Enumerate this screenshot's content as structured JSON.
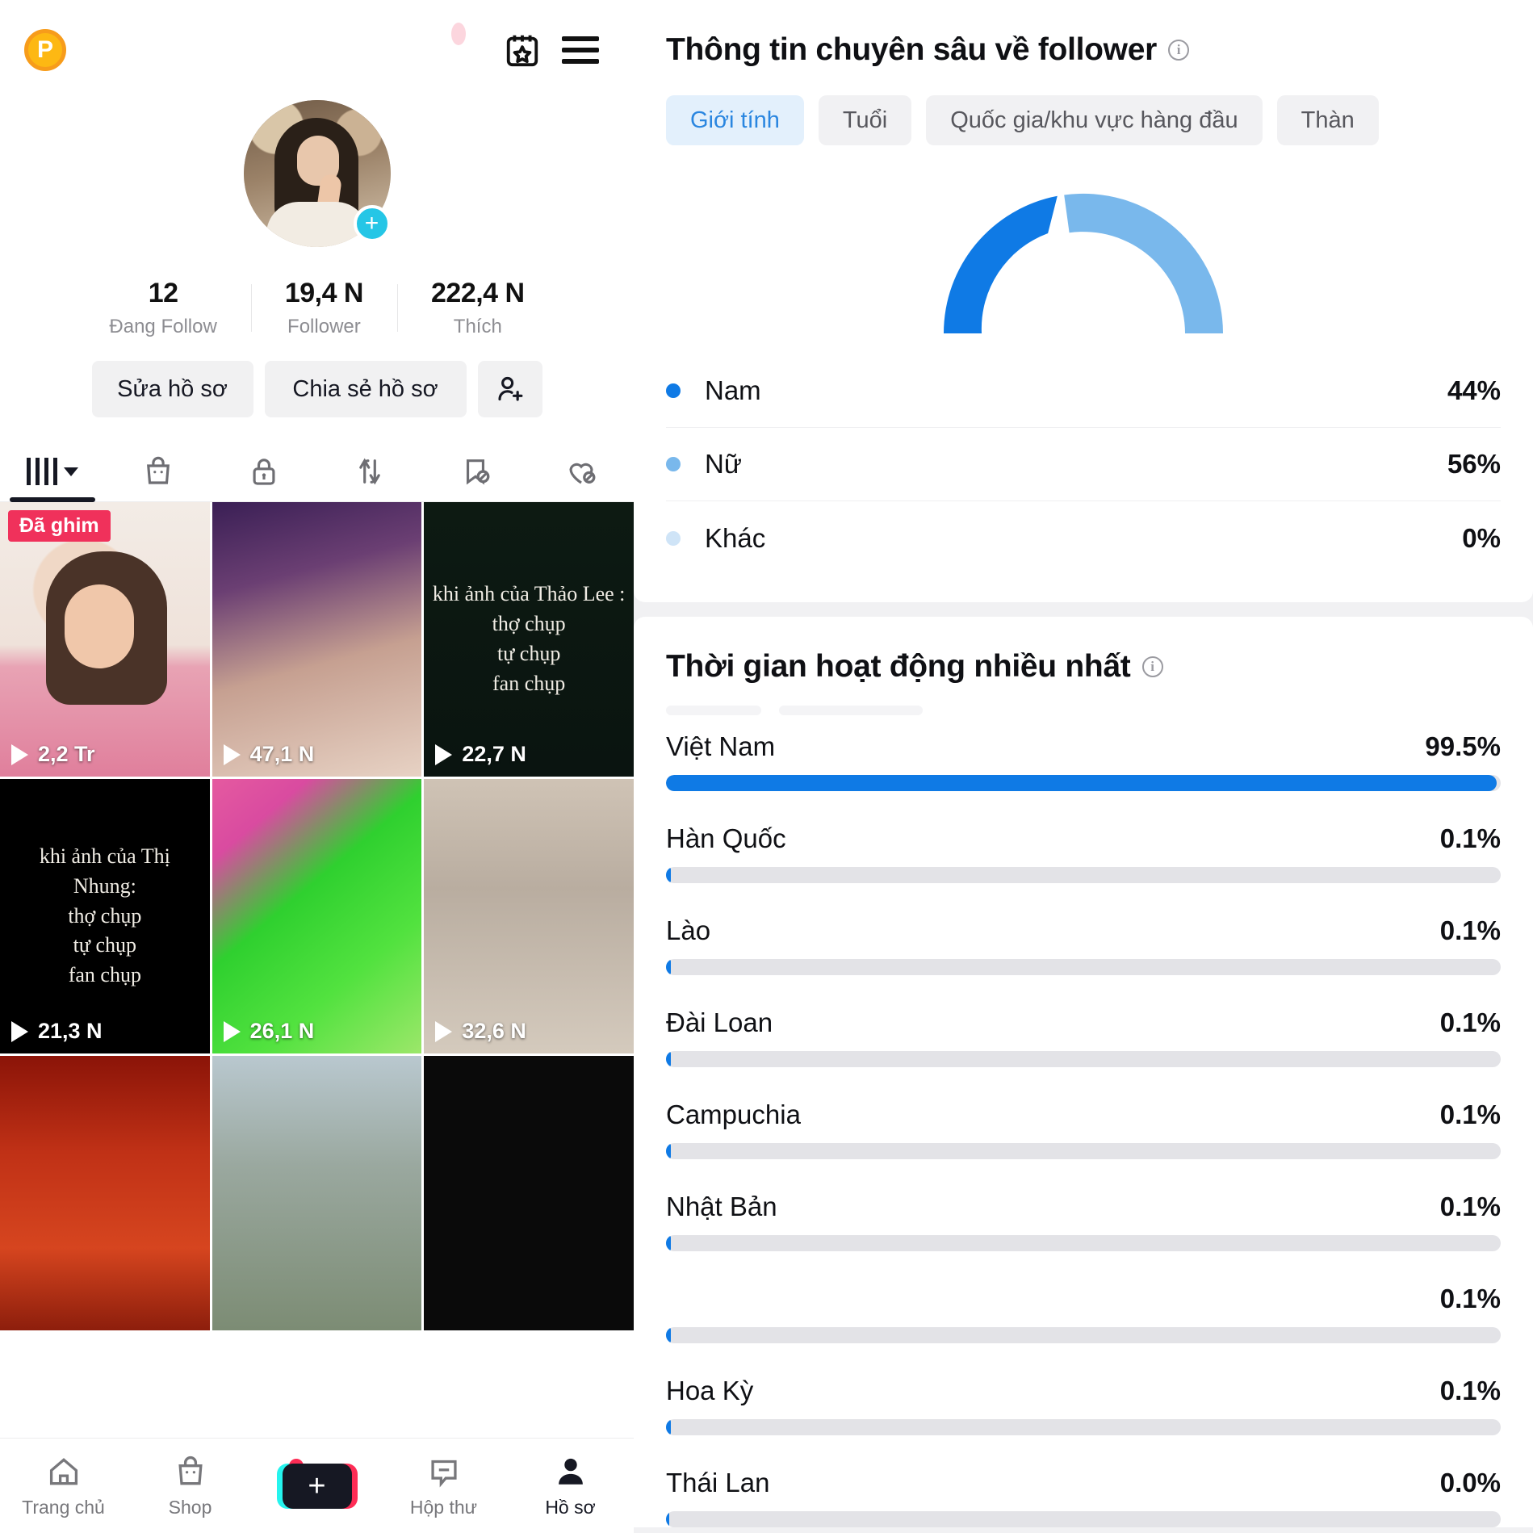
{
  "left": {
    "topbar": {
      "logo_letter": "P",
      "calendar_icon": "calendar-star-icon",
      "menu_icon": "hamburger-menu-icon"
    },
    "profile": {
      "add_badge": "+",
      "stats": [
        {
          "value": "12",
          "label": "Đang Follow"
        },
        {
          "value": "19,4 N",
          "label": "Follower"
        },
        {
          "value": "222,4 N",
          "label": "Thích"
        }
      ],
      "edit_label": "Sửa hồ sơ",
      "share_label": "Chia sẻ hồ sơ",
      "add_friend_icon": "add-person-icon"
    },
    "tabs": [
      {
        "icon": "grid-bars-icon",
        "active": true
      },
      {
        "icon": "shop-bag-icon",
        "active": false
      },
      {
        "icon": "lock-icon",
        "active": false
      },
      {
        "icon": "repost-icon",
        "active": false
      },
      {
        "icon": "bookmark-hidden-icon",
        "active": false
      },
      {
        "icon": "heart-hidden-icon",
        "active": false
      }
    ],
    "grid": [
      {
        "views": "2,2 Tr",
        "badge": "Đã ghim",
        "overlay": "",
        "thumb": "th1"
      },
      {
        "views": "47,1 N",
        "badge": "",
        "overlay": "",
        "thumb": "th2"
      },
      {
        "views": "22,7 N",
        "badge": "",
        "overlay": "khi ảnh của Thảo Lee :\nthợ chụp\ntự chụp\nfan chụp",
        "thumb": "th3"
      },
      {
        "views": "21,3 N",
        "badge": "",
        "overlay": "khi ảnh của Thị Nhung:\nthợ chụp\ntự chụp\nfan chụp",
        "thumb": "th4"
      },
      {
        "views": "26,1 N",
        "badge": "",
        "overlay": "",
        "thumb": "th5"
      },
      {
        "views": "32,6 N",
        "badge": "",
        "overlay": "",
        "thumb": "th6"
      },
      {
        "views": "",
        "badge": "",
        "overlay": "",
        "thumb": "th7"
      },
      {
        "views": "",
        "badge": "",
        "overlay": "",
        "thumb": "th8"
      },
      {
        "views": "",
        "badge": "",
        "overlay": "",
        "thumb": "th9"
      }
    ],
    "bottom_nav": [
      {
        "label": "Trang chủ",
        "icon": "home-icon",
        "active": false
      },
      {
        "label": "Shop",
        "icon": "shop-bag-icon",
        "active": false
      },
      {
        "label": "",
        "icon": "create-plus-icon",
        "active": false
      },
      {
        "label": "Hộp thư",
        "icon": "inbox-message-icon",
        "active": false,
        "has_badge": true
      },
      {
        "label": "Hồ sơ",
        "icon": "person-icon",
        "active": true
      }
    ]
  },
  "right": {
    "follower_card": {
      "title": "Thông tin chuyên sâu về follower",
      "info_icon": "info-icon",
      "chips": [
        {
          "label": "Giới tính",
          "active": true
        },
        {
          "label": "Tuổi",
          "active": false
        },
        {
          "label": "Quốc gia/khu vực hàng đầu",
          "active": false
        },
        {
          "label": "Thàn",
          "active": false
        }
      ]
    },
    "activity_card": {
      "title": "Thời gian hoạt động nhiều nhất",
      "info_icon": "info-icon"
    },
    "colors": {
      "male": "#0f7ae5",
      "female": "#79b8ec",
      "other": "#cfe4f7",
      "bar": "#0f7ae5",
      "track": "#e3e3e7",
      "chip_active_bg": "#e3f0fc",
      "chip_active_text": "#2a86e0"
    }
  },
  "chart_data": [
    {
      "type": "pie",
      "title": "Thông tin chuyên sâu về follower",
      "subtitle": "Giới tính",
      "variant": "half-donut-gauge",
      "labels": [
        "Nam",
        "Nữ",
        "Khác"
      ],
      "values": [
        44,
        56,
        0
      ],
      "value_labels": [
        "44%",
        "56%",
        "0%"
      ],
      "colors": [
        "#0f7ae5",
        "#79b8ec",
        "#cfe4f7"
      ],
      "legend": "below",
      "unit": "%"
    },
    {
      "type": "bar",
      "variant": "horizontal-progress",
      "title": "Thời gian hoạt động nhiều nhất",
      "categories": [
        "Việt Nam",
        "Hàn Quốc",
        "Lào",
        "Đài Loan",
        "Campuchia",
        "Nhật Bản",
        "",
        "Hoa Kỳ",
        "Thái Lan"
      ],
      "values": [
        99.5,
        0.1,
        0.1,
        0.1,
        0.1,
        0.1,
        0.1,
        0.1,
        0.0
      ],
      "value_labels": [
        "99.5%",
        "0.1%",
        "0.1%",
        "0.1%",
        "0.1%",
        "0.1%",
        "0.1%",
        "0.1%",
        "0.0%"
      ],
      "xlabel": "",
      "ylabel": "",
      "xlim": [
        0,
        100
      ],
      "grid": false,
      "bar_color": "#0f7ae5",
      "track_color": "#e3e3e7"
    }
  ]
}
